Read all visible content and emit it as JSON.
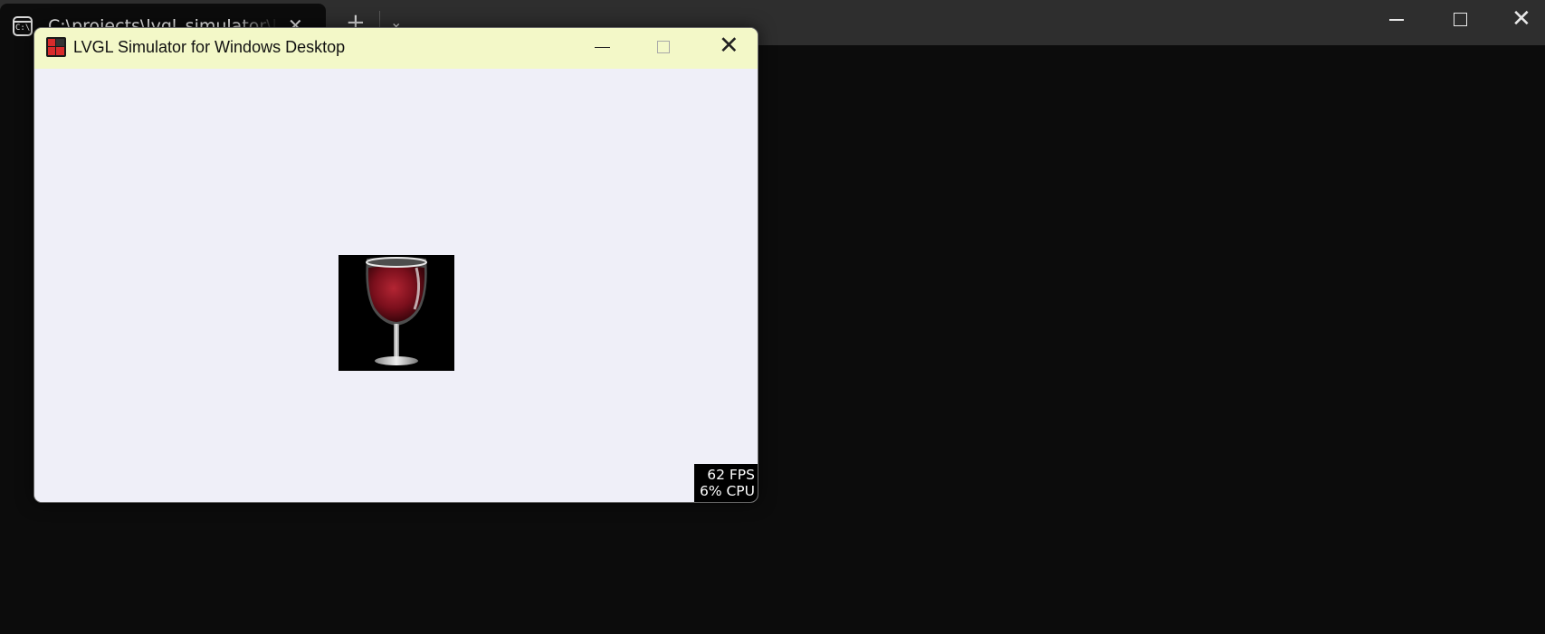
{
  "terminal": {
    "tab_title": "C:\\projects\\lvgl_simulator\\lv",
    "tab_icon": "console-icon",
    "new_tab_icon": "plus-icon",
    "dropdown_icon": "chevron-down-icon",
    "close_tab_icon": "close-icon",
    "window_controls": [
      "minimize-icon",
      "maximize-icon",
      "close-icon"
    ]
  },
  "lvgl_window": {
    "title": "LVGL Simulator for Windows Desktop",
    "app_icon": "lvgl-logo-icon",
    "window_controls": [
      "minimize-icon",
      "maximize-icon",
      "close-icon"
    ],
    "content": {
      "image": "wine-glass-image",
      "perf": {
        "fps": "62 FPS",
        "cpu": "6% CPU"
      }
    }
  },
  "colors": {
    "desktop_bg": "#0c0c0c",
    "terminal_titlebar": "#2e2e2e",
    "lvgl_titlebar": "#f3f8c8",
    "lvgl_content_bg": "#efeff8",
    "lvgl_logo_red": "#d92b2b",
    "wine": "#7a0f1c"
  }
}
